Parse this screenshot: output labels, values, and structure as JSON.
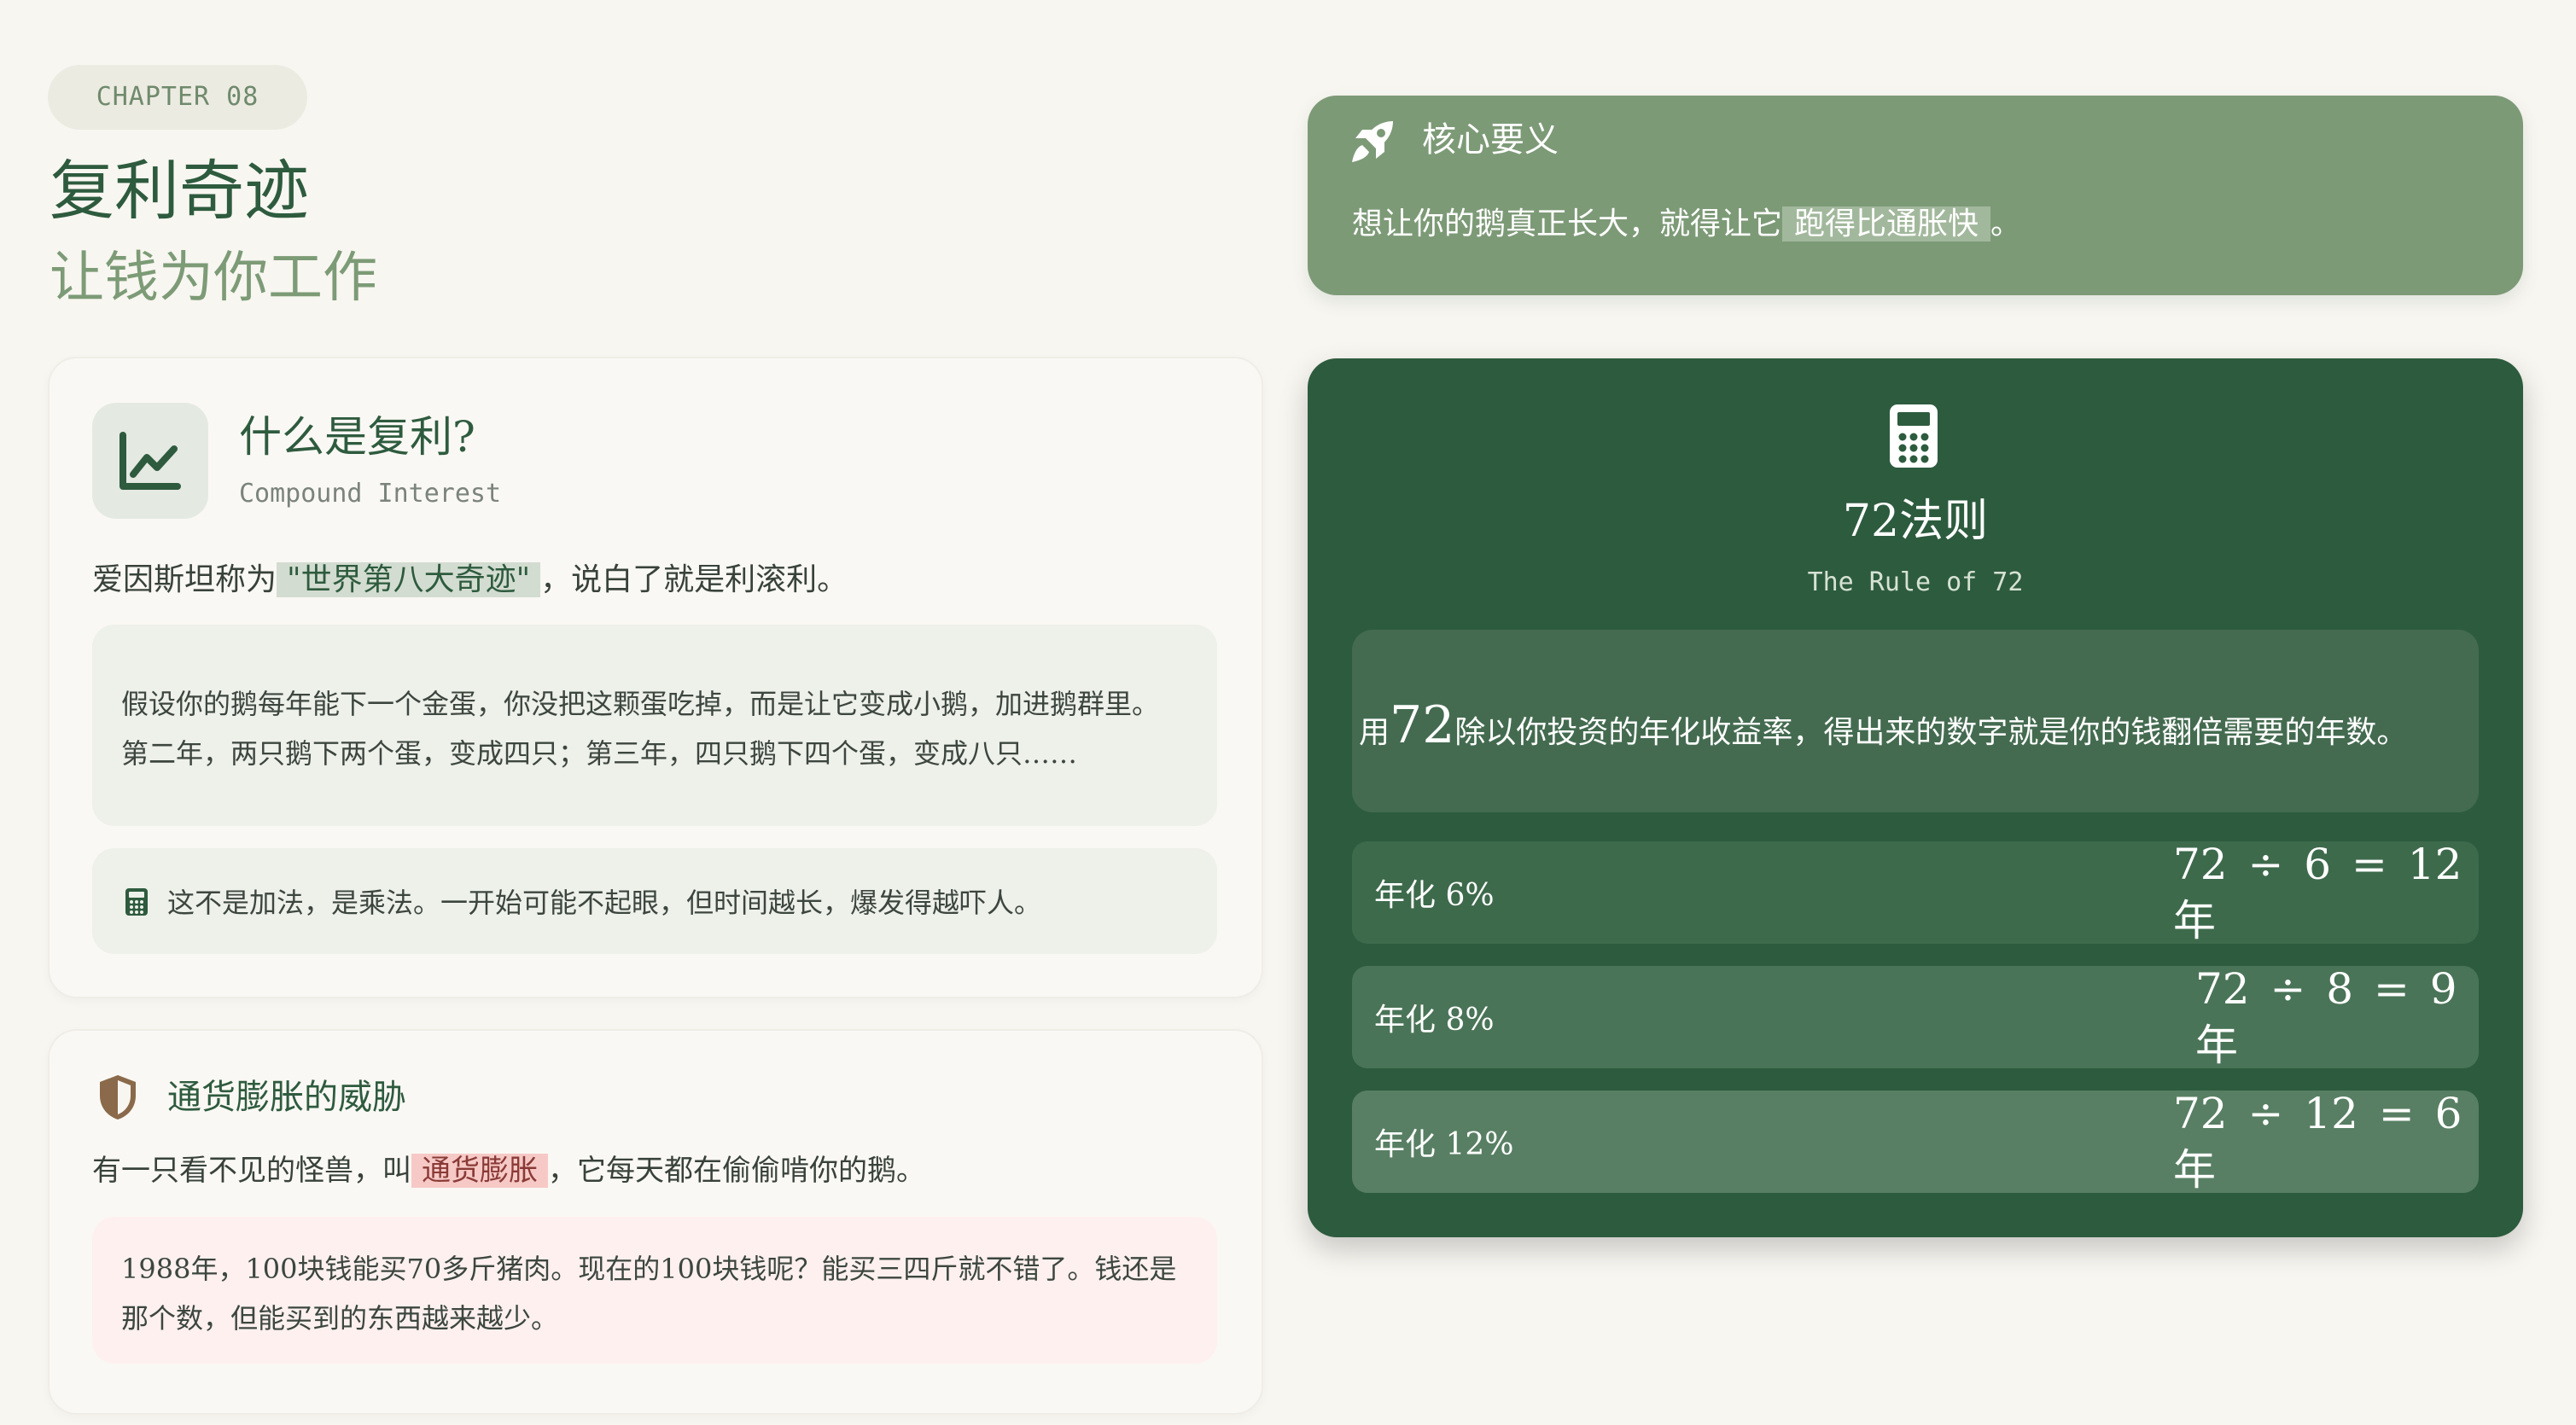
{
  "header": {
    "chapter": "CHAPTER 08",
    "title": "复利奇迹",
    "subtitle": "让钱为你工作"
  },
  "compound": {
    "heading": "什么是复利?",
    "heading_en": "Compound Interest",
    "intro_before": "爱因斯坦称为",
    "intro_highlight": "\"世界第八大奇迹\"",
    "intro_after": "，说白了就是利滚利。",
    "story_line1": "假设你的鹅每年能下一个金蛋，你没把这颗蛋吃掉，而是让它变成小鹅，加进鹅群里。",
    "story_line2": "第二年，两只鹅下两个蛋，变成四只；第三年，四只鹅下四个蛋，变成八只……",
    "tip": "这不是加法，是乘法。一开始可能不起眼，但时间越长，爆发得越吓人。"
  },
  "inflation": {
    "heading": "通货膨胀的威胁",
    "intro_before": "有一只看不见的怪兽，叫",
    "intro_highlight": "通货膨胀",
    "intro_after": "，它每天都在偷偷啃你的鹅。",
    "example_line1": "1988年，100块钱能买70多斤猪肉。现在的100块钱呢？能买三四斤就不错了。钱还是",
    "example_line2": "那个数，但能买到的东西越来越少。"
  },
  "core": {
    "title": "核心要义",
    "text_before": "想让你的鹅真正长大，就得让它",
    "text_highlight": "跑得比通胀快",
    "text_after": "。"
  },
  "rule": {
    "title": "72法则",
    "subtitle": "The Rule of 72",
    "desc_prefix": "用",
    "desc_number": "72",
    "desc_rest": "除以你投资的年化收益率，得出来的数字就是你的钱翻倍需要的年数。",
    "rows": [
      {
        "label": "年化 6%",
        "result": "72 ÷ 6 = 12 年"
      },
      {
        "label": "年化 8%",
        "result": "72 ÷ 8 = 9 年"
      },
      {
        "label": "年化 12%",
        "result": "72 ÷ 12 = 6 年"
      }
    ]
  },
  "colors": {
    "primary_green": "#2d5b3e",
    "sage": "#7d9a77",
    "highlight_red": "#f6c9c6",
    "background": "#f8f6f1"
  },
  "icons": {
    "compound": "chart-line-icon",
    "tip": "calculator-icon",
    "inflation": "shield-icon",
    "core": "rocket-icon",
    "rule": "calculator-icon"
  }
}
